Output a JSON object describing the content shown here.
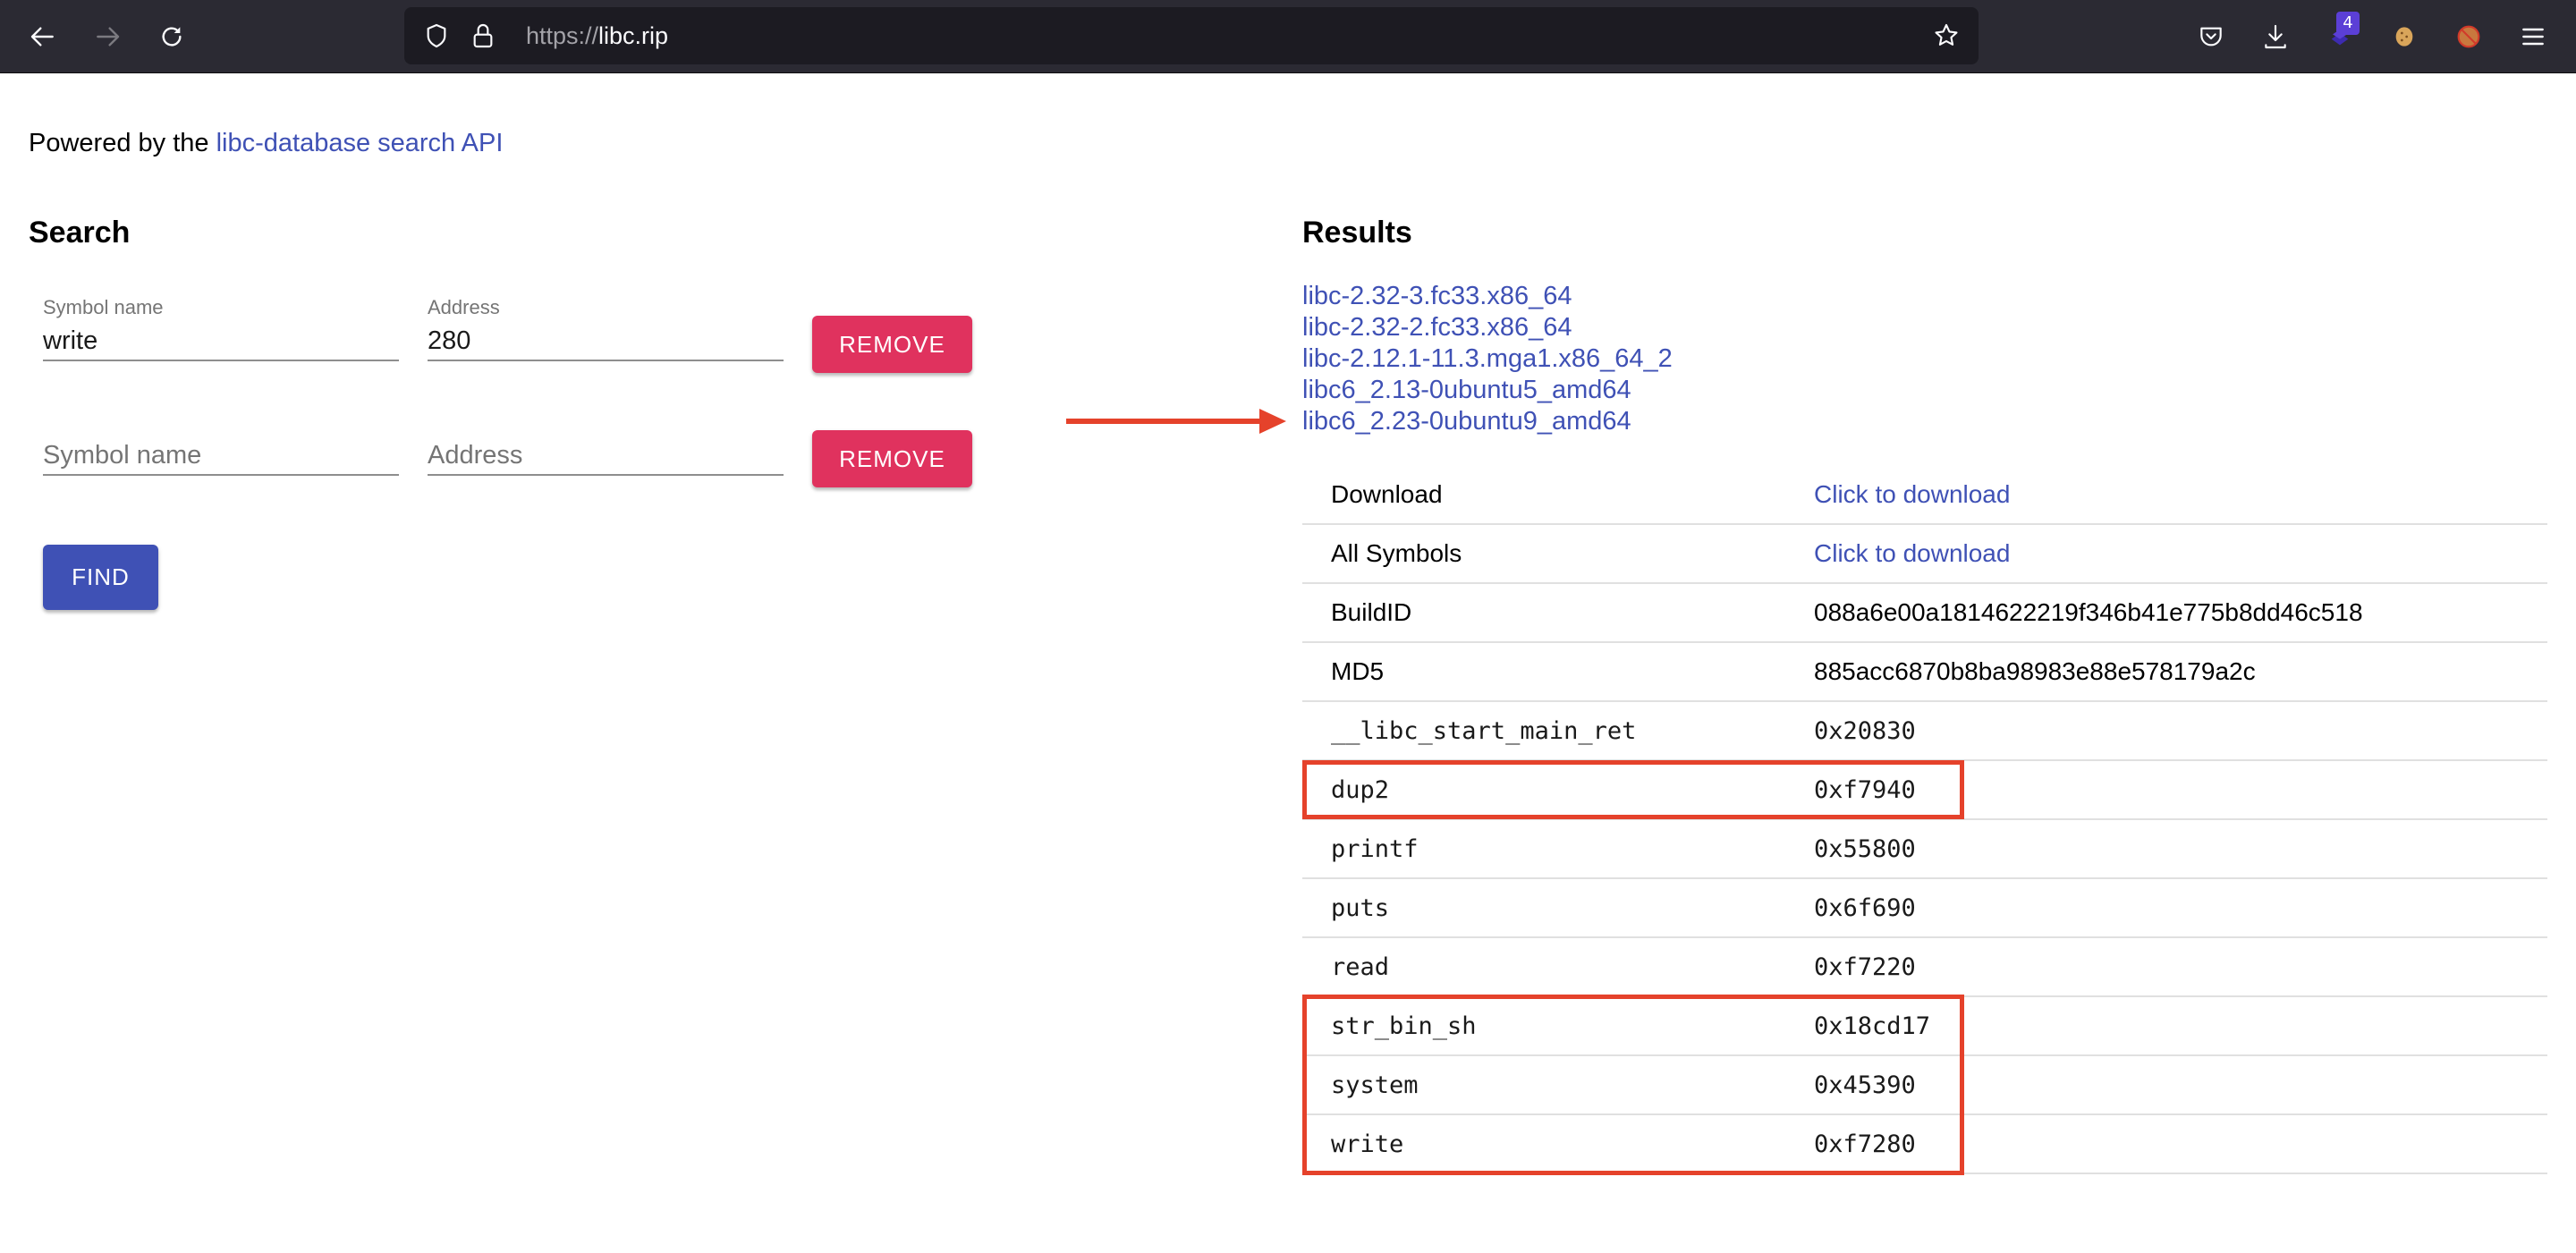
{
  "browser": {
    "url_scheme": "https://",
    "url_host": "libc.rip",
    "icons": {
      "back": "arrow-left-icon",
      "forward": "arrow-right-icon",
      "reload": "reload-icon",
      "tracking": "shield-icon",
      "lock": "lock-icon",
      "bookmark": "star-icon",
      "pocket": "pocket-icon",
      "downloads": "download-icon",
      "extension": "extension-icon",
      "cookie": "cookie-icon",
      "blocker": "no-fox-icon",
      "menu": "hamburger-menu-icon"
    },
    "extension_badge": "4"
  },
  "page": {
    "powered_prefix": "Powered by the ",
    "powered_link": "libc-database search API"
  },
  "search": {
    "title": "Search",
    "rows": [
      {
        "symbol_label": "Symbol name",
        "symbol_value": "write",
        "address_label": "Address",
        "address_value": "280",
        "remove_label": "REMOVE"
      },
      {
        "symbol_placeholder": "Symbol name",
        "symbol_value": "",
        "address_placeholder": "Address",
        "address_value": "",
        "remove_label": "REMOVE"
      }
    ],
    "find_label": "FIND"
  },
  "results": {
    "title": "Results",
    "libs": [
      "libc-2.32-3.fc33.x86_64",
      "libc-2.32-2.fc33.x86_64",
      "libc-2.12.1-11.3.mga1.x86_64_2",
      "libc6_2.13-0ubuntu5_amd64",
      "libc6_2.23-0ubuntu9_amd64"
    ],
    "selected_lib": "libc6_2.23-0ubuntu9_amd64",
    "info": [
      {
        "key": "Download",
        "value": "Click to download",
        "link": true
      },
      {
        "key": "All Symbols",
        "value": "Click to download",
        "link": true
      },
      {
        "key": "BuildID",
        "value": "088a6e00a1814622219f346b41e775b8dd46c518"
      },
      {
        "key": "MD5",
        "value": "885acc6870b8ba98983e88e578179a2c"
      }
    ],
    "symbols": [
      {
        "name": "__libc_start_main_ret",
        "address": "0x20830"
      },
      {
        "name": "dup2",
        "address": "0xf7940",
        "highlighted": true
      },
      {
        "name": "printf",
        "address": "0x55800"
      },
      {
        "name": "puts",
        "address": "0x6f690"
      },
      {
        "name": "read",
        "address": "0xf7220"
      },
      {
        "name": "str_bin_sh",
        "address": "0x18cd17",
        "highlighted": true
      },
      {
        "name": "system",
        "address": "0x45390",
        "highlighted": true
      },
      {
        "name": "write",
        "address": "0xf7280",
        "highlighted": true
      }
    ]
  },
  "colors": {
    "link": "#3f51b5",
    "remove_button": "#e0325e",
    "find_button": "#3f51b5",
    "annotation_red": "#e5422b",
    "toolbar_bg": "#2b2a33"
  }
}
